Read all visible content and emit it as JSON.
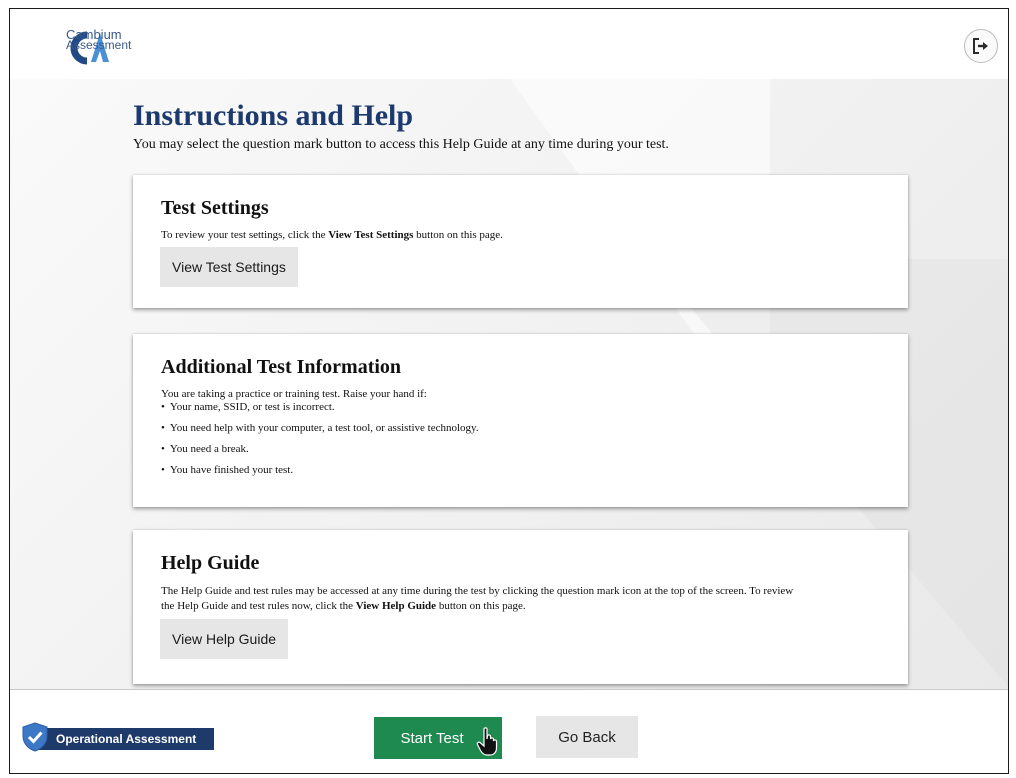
{
  "header": {
    "logo_line1": "Cambium",
    "logo_line2": "Assessment",
    "logout_icon": "logout-icon"
  },
  "main": {
    "title": "Instructions and Help",
    "subtitle": "You may select the question mark button to access this Help Guide at any time during your test."
  },
  "test_settings": {
    "heading": "Test Settings",
    "text_before": "To review your test settings, click the ",
    "text_bold": "View Test Settings",
    "text_after": " button on this page.",
    "button_label": "View Test Settings"
  },
  "additional_info": {
    "heading": "Additional Test Information",
    "intro": "You are taking a practice or training test. Raise your hand if:",
    "items": [
      "Your name, SSID, or test is incorrect.",
      "You need help with your computer, a test tool, or assistive technology.",
      "You need a break.",
      "You have finished your test."
    ]
  },
  "help_guide": {
    "heading": "Help Guide",
    "line1": "The Help Guide and test rules may be accessed at any time during the test by clicking the question mark icon at the top of the screen. To review",
    "line2_before": "the Help Guide and test rules now, click the ",
    "line2_bold": "View Help Guide",
    "line2_after": " button on this page.",
    "button_label": "View Help Guide"
  },
  "footer": {
    "badge_label": "Operational Assessment",
    "badge_icon": "shield-check-icon",
    "start_label": "Start Test",
    "back_label": "Go Back"
  },
  "colors": {
    "brand_blue": "#1d3a6e",
    "start_green": "#1e8a50",
    "button_gray": "#e6e6e6"
  }
}
